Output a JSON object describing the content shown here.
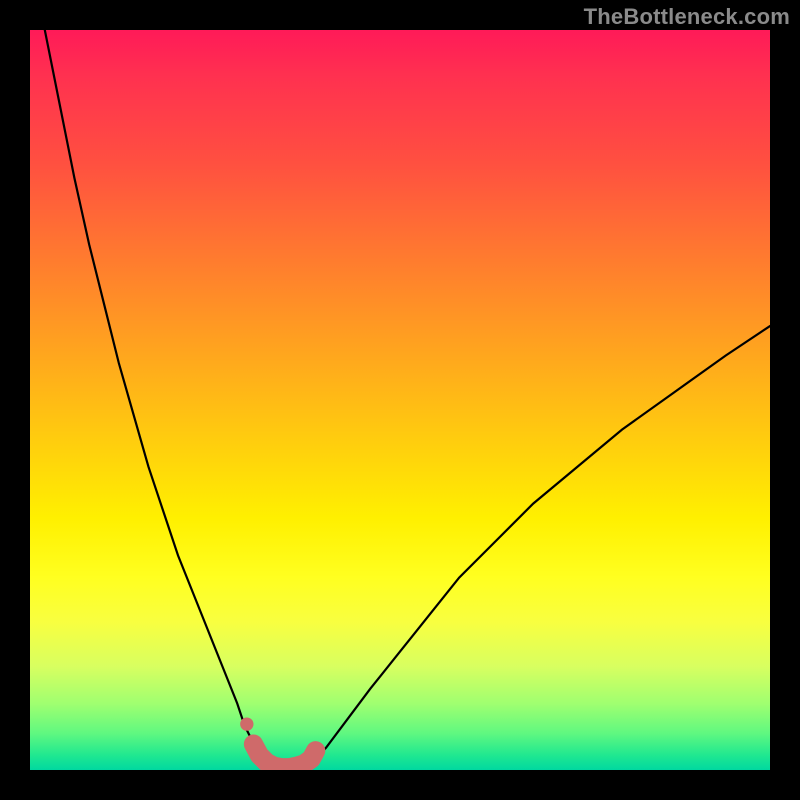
{
  "watermark": "TheBottleneck.com",
  "chart_data": {
    "type": "line",
    "title": "",
    "xlabel": "",
    "ylabel": "",
    "xlim": [
      0,
      100
    ],
    "ylim": [
      0,
      100
    ],
    "grid": false,
    "legend": false,
    "annotations": [],
    "series": [
      {
        "name": "left-branch",
        "x": [
          2,
          4,
          6,
          8,
          10,
          12,
          14,
          16,
          18,
          20,
          22,
          24,
          26,
          28,
          29,
          30,
          31,
          32
        ],
        "values": [
          100,
          90,
          80,
          71,
          63,
          55,
          48,
          41,
          35,
          29,
          24,
          19,
          14,
          9,
          6,
          4,
          2,
          1
        ]
      },
      {
        "name": "valley-floor",
        "x": [
          32,
          33,
          34,
          35,
          36,
          37,
          38
        ],
        "values": [
          1,
          0.5,
          0.3,
          0.3,
          0.3,
          0.5,
          1
        ]
      },
      {
        "name": "right-branch",
        "x": [
          38,
          40,
          43,
          46,
          50,
          54,
          58,
          63,
          68,
          74,
          80,
          87,
          94,
          100
        ],
        "values": [
          1,
          3,
          7,
          11,
          16,
          21,
          26,
          31,
          36,
          41,
          46,
          51,
          56,
          60
        ]
      }
    ],
    "highlight_segments": [
      {
        "name": "lower-left-marker-dot",
        "shape": "dot",
        "x": 29.3,
        "y": 6.2,
        "radius_pct": 0.9
      },
      {
        "name": "valley-marker-stroke",
        "shape": "path",
        "x": [
          30.2,
          31,
          32,
          33,
          34,
          35,
          36,
          37,
          38,
          38.6
        ],
        "values": [
          3.5,
          2.0,
          1.0,
          0.5,
          0.3,
          0.3,
          0.5,
          0.8,
          1.5,
          2.6
        ],
        "width_pct": 2.6
      }
    ],
    "colors": {
      "curve": "#000000",
      "highlight": "#cf6a6a",
      "gradient_top": "#ff1a58",
      "gradient_mid": "#fff000",
      "gradient_bottom": "#00d8a0"
    }
  }
}
